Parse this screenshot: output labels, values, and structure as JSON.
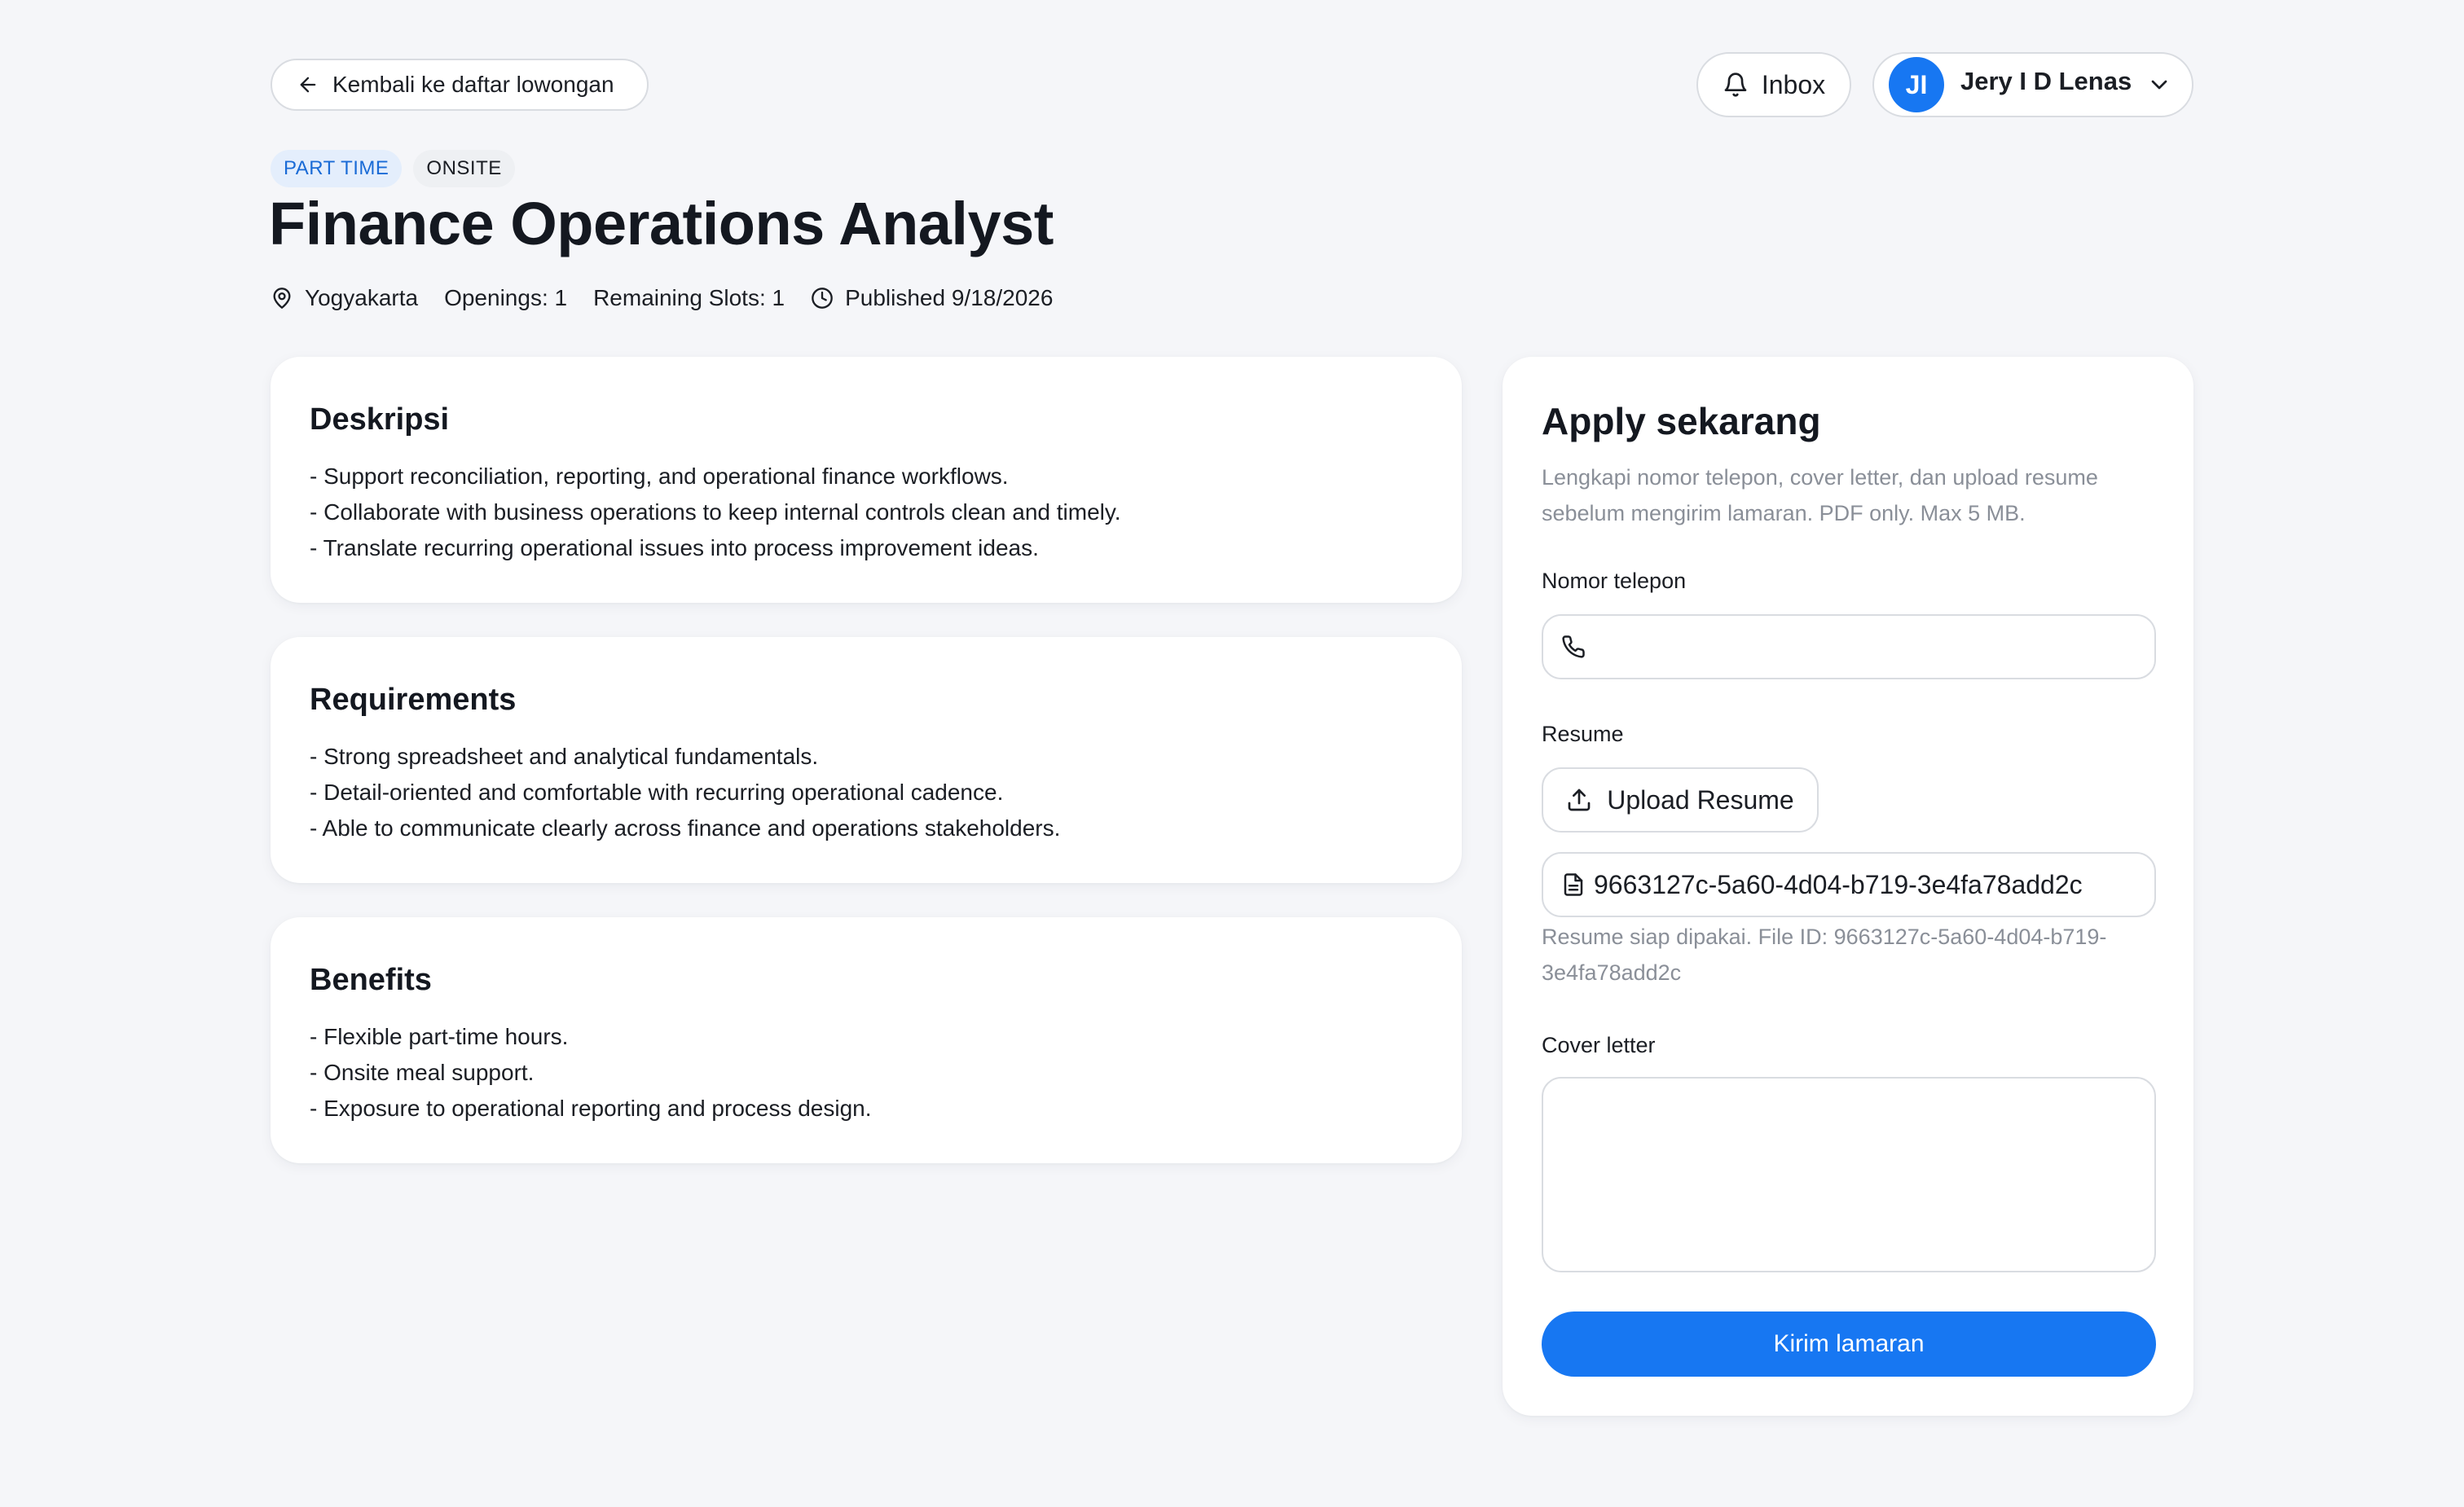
{
  "nav": {
    "back_label": "Kembali ke daftar lowongan",
    "inbox_label": "Inbox",
    "user": {
      "initials": "JI",
      "name": "Jery I D Lenas"
    }
  },
  "job": {
    "badges": [
      "PART TIME",
      "ONSITE"
    ],
    "title": "Finance Operations Analyst",
    "location": "Yogyakarta",
    "openings": "Openings: 1",
    "remaining": "Remaining Slots: 1",
    "published": "Published 9/18/2026"
  },
  "sections": [
    {
      "heading": "Deskripsi",
      "lines": [
        "- Support reconciliation, reporting, and operational finance workflows.",
        "- Collaborate with business operations to keep internal controls clean and timely.",
        "- Translate recurring operational issues into process improvement ideas."
      ]
    },
    {
      "heading": "Requirements",
      "lines": [
        "- Strong spreadsheet and analytical fundamentals.",
        "- Detail-oriented and comfortable with recurring operational cadence.",
        "- Able to communicate clearly across finance and operations stakeholders."
      ]
    },
    {
      "heading": "Benefits",
      "lines": [
        "- Flexible part-time hours.",
        "- Onsite meal support.",
        "- Exposure to operational reporting and process design."
      ]
    }
  ],
  "apply": {
    "title": "Apply sekarang",
    "subtitle": "Lengkapi nomor telepon, cover letter, dan upload resume sebelum mengirim lamaran. PDF only. Max 5 MB.",
    "phone_label": "Nomor telepon",
    "phone_value": "",
    "resume_label": "Resume",
    "upload_label": "Upload Resume",
    "file_name": "9663127c-5a60-4d04-b719-3e4fa78add2c",
    "resume_hint_line1": "Resume siap dipakai. File ID: 9663127c-5a60-4d04-b719-",
    "resume_hint_line2": "3e4fa78add2c",
    "cover_label": "Cover letter",
    "cover_value": "",
    "submit_label": "Kirim lamaran"
  },
  "colors": {
    "background": "#f5f6f9",
    "primary": "#1777f2",
    "badge_part_bg": "#e4eefc",
    "badge_part_text": "#1a6bd6",
    "muted_text": "#8a8f98"
  },
  "icons": {
    "back": "arrow-left-icon",
    "inbox": "bell-icon",
    "user_menu": "chevron-down-icon",
    "location": "map-pin-icon",
    "published": "clock-icon",
    "phone": "phone-icon",
    "upload": "upload-icon",
    "file": "file-icon"
  }
}
